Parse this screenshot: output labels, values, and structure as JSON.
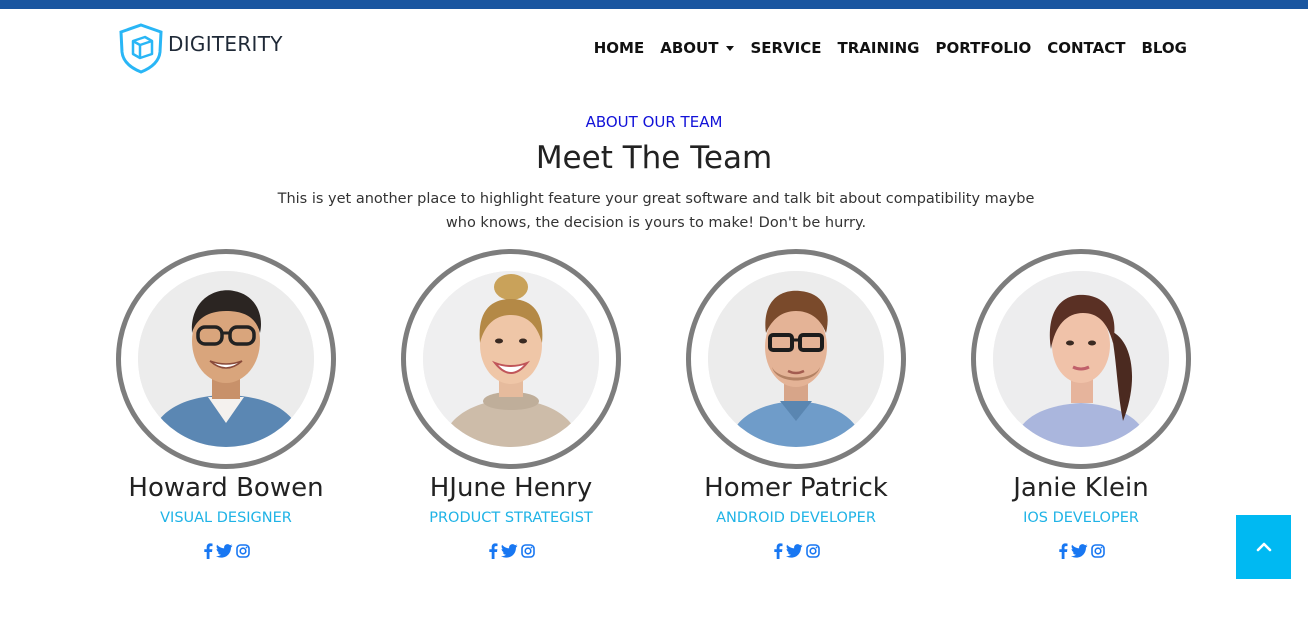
{
  "brand": {
    "name": "DIGITERITY",
    "icon": "cube-shield-logo",
    "accent": "#29b6f6"
  },
  "top_bar_color": "#1a56a0",
  "nav": {
    "items": [
      {
        "label": "HOME"
      },
      {
        "label": "ABOUT",
        "has_dropdown": true
      },
      {
        "label": "SERVICE"
      },
      {
        "label": "TRAINING"
      },
      {
        "label": "PORTFOLIO"
      },
      {
        "label": "CONTACT"
      },
      {
        "label": "BLOG"
      }
    ]
  },
  "section": {
    "eyebrow": "ABOUT OUR TEAM",
    "title": "Meet The Team",
    "description": "This is yet another place to highlight feature your great software and talk bit about compatibility maybe who knows, the decision is yours to make! Don't be hurry."
  },
  "team": [
    {
      "name": "Howard Bowen",
      "role": "VISUAL DESIGNER",
      "photo": "man-with-glasses-denim-shirt"
    },
    {
      "name": "HJune Henry",
      "role": "PRODUCT STRATEGIST",
      "photo": "woman-bun-turtleneck"
    },
    {
      "name": "Homer Patrick",
      "role": "ANDROID DEVELOPER",
      "photo": "man-glasses-beard"
    },
    {
      "name": "Janie Klein",
      "role": "IOS DEVELOPER",
      "photo": "woman-ponytail-striped-shirt"
    }
  ],
  "social_icons": [
    "facebook-icon",
    "twitter-icon",
    "instagram-icon"
  ],
  "colors": {
    "eyebrow": "#1212d8",
    "role": "#1fb3e6",
    "social": "#1877f2",
    "scroll_top": "#00b9f2",
    "ring": "#7d7d7d"
  },
  "scroll_top_icon": "chevron-up-icon"
}
